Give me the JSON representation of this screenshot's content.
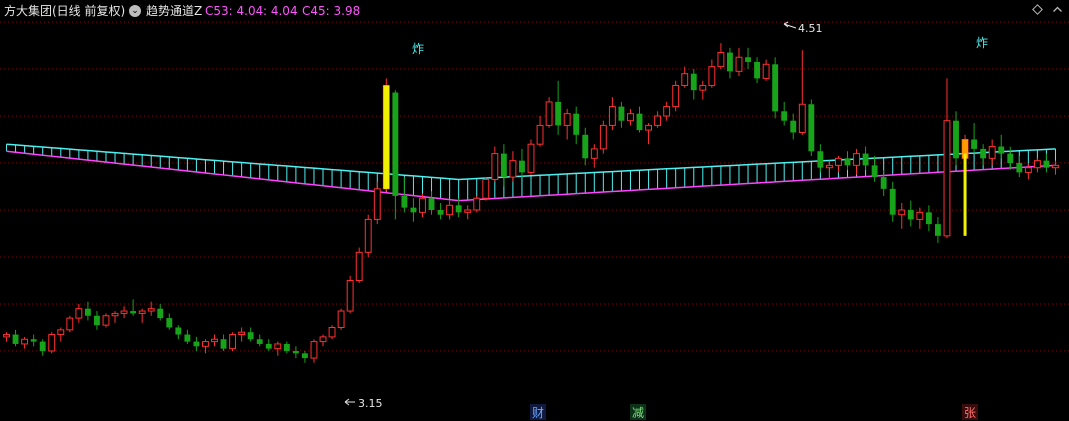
{
  "header": {
    "title": "方大集团(日线 前复权)",
    "chevron": "⌄",
    "indicator_name": "趋势通道Z",
    "c53_label": "C53: 4.04",
    "c53_sep": ": 4.04",
    "c45_label": "C45: 3.98"
  },
  "annotations": {
    "high_label": "4.51",
    "low_label": "3.15",
    "zha1": "炸",
    "zha2": "炸",
    "cai": "财",
    "jian": "减",
    "zhang": "张"
  },
  "colors": {
    "up": "#ff3030",
    "down": "#17a31a",
    "channel_upper": "#4ff0f0",
    "channel_lower": "#ff44ff",
    "yellow": "#f0f000",
    "orange": "#ff9a00",
    "grid": "#8b0000"
  },
  "chart_data": {
    "type": "candlestick",
    "ylim": [
      3.0,
      4.6
    ],
    "candles": [
      [
        3.26,
        3.28,
        3.24,
        3.27
      ],
      [
        3.27,
        3.29,
        3.22,
        3.23
      ],
      [
        3.23,
        3.26,
        3.21,
        3.25
      ],
      [
        3.25,
        3.27,
        3.22,
        3.24
      ],
      [
        3.24,
        3.25,
        3.18,
        3.2
      ],
      [
        3.2,
        3.28,
        3.19,
        3.27
      ],
      [
        3.27,
        3.3,
        3.24,
        3.29
      ],
      [
        3.29,
        3.35,
        3.28,
        3.34
      ],
      [
        3.34,
        3.4,
        3.32,
        3.38
      ],
      [
        3.38,
        3.41,
        3.33,
        3.35
      ],
      [
        3.35,
        3.37,
        3.29,
        3.31
      ],
      [
        3.31,
        3.36,
        3.3,
        3.35
      ],
      [
        3.35,
        3.37,
        3.32,
        3.36
      ],
      [
        3.36,
        3.39,
        3.34,
        3.37
      ],
      [
        3.37,
        3.42,
        3.35,
        3.36
      ],
      [
        3.36,
        3.38,
        3.32,
        3.37
      ],
      [
        3.37,
        3.41,
        3.35,
        3.38
      ],
      [
        3.38,
        3.4,
        3.33,
        3.34
      ],
      [
        3.34,
        3.36,
        3.29,
        3.3
      ],
      [
        3.3,
        3.31,
        3.25,
        3.27
      ],
      [
        3.27,
        3.29,
        3.23,
        3.24
      ],
      [
        3.24,
        3.26,
        3.2,
        3.22
      ],
      [
        3.22,
        3.25,
        3.19,
        3.24
      ],
      [
        3.24,
        3.27,
        3.22,
        3.25
      ],
      [
        3.25,
        3.27,
        3.2,
        3.21
      ],
      [
        3.21,
        3.28,
        3.2,
        3.27
      ],
      [
        3.27,
        3.3,
        3.24,
        3.28
      ],
      [
        3.28,
        3.3,
        3.24,
        3.25
      ],
      [
        3.25,
        3.27,
        3.22,
        3.23
      ],
      [
        3.23,
        3.25,
        3.2,
        3.21
      ],
      [
        3.21,
        3.24,
        3.18,
        3.23
      ],
      [
        3.23,
        3.24,
        3.19,
        3.2
      ],
      [
        3.2,
        3.22,
        3.17,
        3.19
      ],
      [
        3.19,
        3.2,
        3.15,
        3.17
      ],
      [
        3.17,
        3.25,
        3.15,
        3.24
      ],
      [
        3.24,
        3.27,
        3.22,
        3.26
      ],
      [
        3.26,
        3.31,
        3.25,
        3.3
      ],
      [
        3.3,
        3.38,
        3.29,
        3.37
      ],
      [
        3.37,
        3.52,
        3.36,
        3.5
      ],
      [
        3.5,
        3.64,
        3.49,
        3.62
      ],
      [
        3.62,
        3.78,
        3.6,
        3.76
      ],
      [
        3.76,
        3.92,
        3.74,
        3.89
      ],
      [
        3.89,
        4.36,
        3.88,
        4.33
      ],
      [
        4.3,
        4.31,
        3.76,
        3.86
      ],
      [
        3.86,
        3.94,
        3.79,
        3.81
      ],
      [
        3.81,
        3.85,
        3.75,
        3.79
      ],
      [
        3.79,
        3.87,
        3.77,
        3.85
      ],
      [
        3.85,
        3.88,
        3.78,
        3.8
      ],
      [
        3.8,
        3.83,
        3.76,
        3.78
      ],
      [
        3.78,
        3.84,
        3.76,
        3.82
      ],
      [
        3.82,
        3.85,
        3.77,
        3.79
      ],
      [
        3.79,
        3.82,
        3.76,
        3.8
      ],
      [
        3.8,
        3.86,
        3.79,
        3.85
      ],
      [
        3.85,
        3.94,
        3.84,
        3.93
      ],
      [
        3.93,
        4.07,
        3.92,
        4.04
      ],
      [
        4.04,
        4.08,
        3.9,
        3.94
      ],
      [
        3.94,
        4.05,
        3.92,
        4.01
      ],
      [
        4.01,
        4.06,
        3.94,
        3.96
      ],
      [
        3.96,
        4.1,
        3.95,
        4.08
      ],
      [
        4.08,
        4.2,
        4.07,
        4.16
      ],
      [
        4.16,
        4.28,
        4.15,
        4.26
      ],
      [
        4.26,
        4.35,
        4.12,
        4.16
      ],
      [
        4.16,
        4.23,
        4.1,
        4.21
      ],
      [
        4.21,
        4.24,
        4.08,
        4.12
      ],
      [
        4.12,
        4.15,
        3.99,
        4.02
      ],
      [
        4.02,
        4.08,
        3.98,
        4.06
      ],
      [
        4.06,
        4.18,
        4.04,
        4.16
      ],
      [
        4.16,
        4.28,
        4.14,
        4.24
      ],
      [
        4.24,
        4.26,
        4.15,
        4.18
      ],
      [
        4.18,
        4.23,
        4.16,
        4.21
      ],
      [
        4.21,
        4.24,
        4.13,
        4.14
      ],
      [
        4.14,
        4.17,
        4.08,
        4.16
      ],
      [
        4.16,
        4.22,
        4.15,
        4.2
      ],
      [
        4.2,
        4.26,
        4.18,
        4.24
      ],
      [
        4.24,
        4.35,
        4.22,
        4.33
      ],
      [
        4.33,
        4.41,
        4.32,
        4.38
      ],
      [
        4.38,
        4.4,
        4.27,
        4.31
      ],
      [
        4.31,
        4.35,
        4.27,
        4.33
      ],
      [
        4.33,
        4.44,
        4.32,
        4.41
      ],
      [
        4.41,
        4.51,
        4.4,
        4.47
      ],
      [
        4.47,
        4.49,
        4.36,
        4.39
      ],
      [
        4.39,
        4.49,
        4.37,
        4.45
      ],
      [
        4.45,
        4.49,
        4.4,
        4.43
      ],
      [
        4.43,
        4.45,
        4.34,
        4.36
      ],
      [
        4.36,
        4.44,
        4.35,
        4.42
      ],
      [
        4.42,
        4.45,
        4.19,
        4.22
      ],
      [
        4.22,
        4.26,
        4.16,
        4.18
      ],
      [
        4.18,
        4.21,
        4.1,
        4.13
      ],
      [
        4.13,
        4.48,
        4.12,
        4.25
      ],
      [
        4.25,
        4.27,
        4.03,
        4.05
      ],
      [
        4.05,
        4.08,
        3.96,
        3.98
      ],
      [
        3.98,
        4.01,
        3.93,
        3.99
      ],
      [
        3.99,
        4.03,
        3.96,
        4.02
      ],
      [
        4.02,
        4.05,
        3.97,
        3.99
      ],
      [
        3.99,
        4.06,
        3.95,
        4.04
      ],
      [
        4.04,
        4.07,
        3.97,
        3.99
      ],
      [
        3.99,
        4.03,
        3.92,
        3.94
      ],
      [
        3.94,
        3.97,
        3.86,
        3.89
      ],
      [
        3.89,
        3.92,
        3.75,
        3.78
      ],
      [
        3.78,
        3.83,
        3.72,
        3.8
      ],
      [
        3.8,
        3.84,
        3.73,
        3.76
      ],
      [
        3.76,
        3.81,
        3.72,
        3.79
      ],
      [
        3.79,
        3.82,
        3.71,
        3.74
      ],
      [
        3.74,
        3.77,
        3.66,
        3.69
      ],
      [
        3.69,
        4.36,
        3.68,
        4.18
      ],
      [
        4.18,
        4.22,
        3.99,
        4.02
      ],
      [
        4.02,
        4.12,
        3.97,
        4.1
      ],
      [
        4.1,
        4.17,
        4.04,
        4.06
      ],
      [
        4.06,
        4.08,
        3.99,
        4.02
      ],
      [
        4.02,
        4.1,
        3.99,
        4.07
      ],
      [
        4.07,
        4.12,
        4.02,
        4.04
      ],
      [
        4.04,
        4.07,
        3.97,
        4.0
      ],
      [
        4.0,
        4.03,
        3.94,
        3.96
      ],
      [
        3.96,
        4.0,
        3.93,
        3.98
      ],
      [
        3.98,
        4.02,
        3.96,
        4.01
      ],
      [
        4.01,
        4.04,
        3.96,
        3.98
      ],
      [
        3.98,
        4.01,
        3.95,
        3.99
      ]
    ],
    "channel_upper": {
      "start": 4.08,
      "mid": 3.93,
      "mid_index": 50,
      "end": 4.06
    },
    "channel_lower": {
      "start": 4.05,
      "mid": 3.84,
      "mid_index": 50,
      "end": 3.99
    }
  }
}
